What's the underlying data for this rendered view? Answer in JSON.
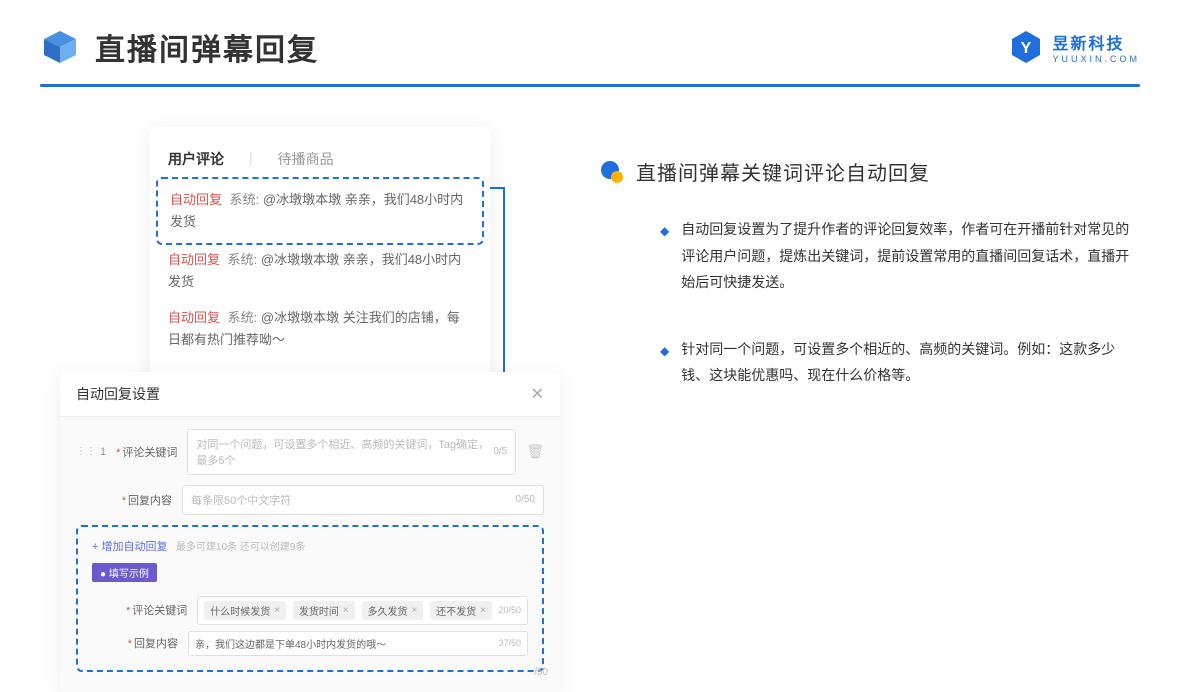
{
  "header": {
    "title": "直播间弹幕回复",
    "brand_name": "昱新科技",
    "brand_url": "YUUXIN.COM"
  },
  "comments_card": {
    "tabs": {
      "active": "用户评论",
      "inactive": "待播商品"
    },
    "items": [
      {
        "tag": "自动回复",
        "sys": "系统:",
        "text": "@冰墩墩本墩 亲亲，我们48小时内发货"
      },
      {
        "tag": "自动回复",
        "sys": "系统:",
        "text": "@冰墩墩本墩 亲亲，我们48小时内发货"
      },
      {
        "tag": "自动回复",
        "sys": "系统:",
        "text": "@冰墩墩本墩 关注我们的店铺，每日都有热门推荐呦～"
      }
    ]
  },
  "settings_card": {
    "title": "自动回复设置",
    "index": "1",
    "row1_label": "评论关键词",
    "row1_placeholder": "对同一个问题，可设置多个相近、高频的关键词，Tag确定，最多5个",
    "row1_counter": "0/5",
    "row2_label": "回复内容",
    "row2_placeholder": "每条限50个中文字符",
    "row2_counter": "0/50",
    "add_link": "+ 增加自动回复",
    "add_tip": "最多可建10条 还可以创建9条",
    "badge": "● 填写示例",
    "ex_row1_label": "评论关键词",
    "ex_tags": [
      "什么时候发货",
      "发货时间",
      "多久发货",
      "还不发货"
    ],
    "ex_row1_counter": "20/50",
    "ex_row2_label": "回复内容",
    "ex_row2_text": "亲，我们这边都是下单48小时内发货的哦～",
    "ex_row2_counter": "37/50",
    "side_counter": "/50"
  },
  "right": {
    "section_title": "直播间弹幕关键词评论自动回复",
    "bullets": [
      "自动回复设置为了提升作者的评论回复效率，作者可在开播前针对常见的评论用户问题，提炼出关键词，提前设置常用的直播间回复话术，直播开始后可快捷发送。",
      "针对同一个问题，可设置多个相近的、高频的关键词。例如：这款多少钱、这块能优惠吗、现在什么价格等。"
    ]
  }
}
